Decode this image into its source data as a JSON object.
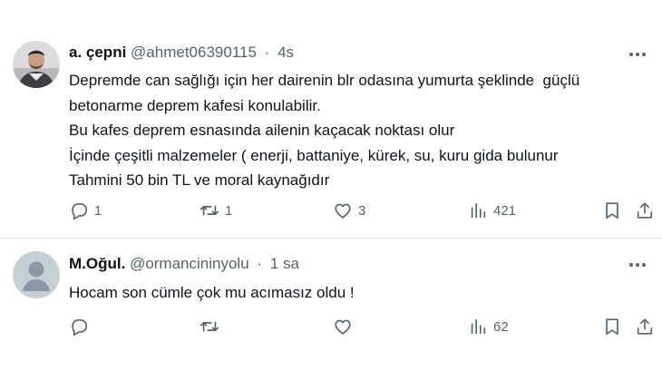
{
  "tweets": [
    {
      "name": "a. çepni",
      "handle": "@ahmet06390115",
      "separator": "·",
      "time": "4s",
      "lines": [
        "Depremde can sağlığı için her dairenin blr odasına yumurta şeklinde  güçlü",
        "betonarme deprem kafesi konulabilir.",
        "Bu kafes deprem esnasında ailenin kaçacak noktası olur",
        "İçinde çeşitli malzemeler ( enerji, battaniye, kürek, su, kuru gida bulunur",
        "Tahmini 50 bin TL ve moral kaynağıdır"
      ],
      "counts": {
        "replies": "1",
        "retweets": "1",
        "likes": "3",
        "views": "421"
      }
    },
    {
      "name": "M.Oğul.",
      "handle": "@ormancininyolu",
      "separator": "·",
      "time": "1 sa",
      "lines": [
        "Hocam son cümle çok mu acımasız oldu !"
      ],
      "counts": {
        "replies": "",
        "retweets": "",
        "likes": "",
        "views": "62"
      }
    }
  ],
  "icons": {
    "more": "more-horizontal-icon",
    "reply": "reply-bubble-icon",
    "retweet": "retweet-icon",
    "like": "heart-icon",
    "views": "views-bar-chart-icon",
    "bookmark": "bookmark-icon",
    "share": "share-upload-icon"
  },
  "colors": {
    "text": "#0f1419",
    "secondary": "#536471",
    "divider": "#e1e6ea"
  }
}
